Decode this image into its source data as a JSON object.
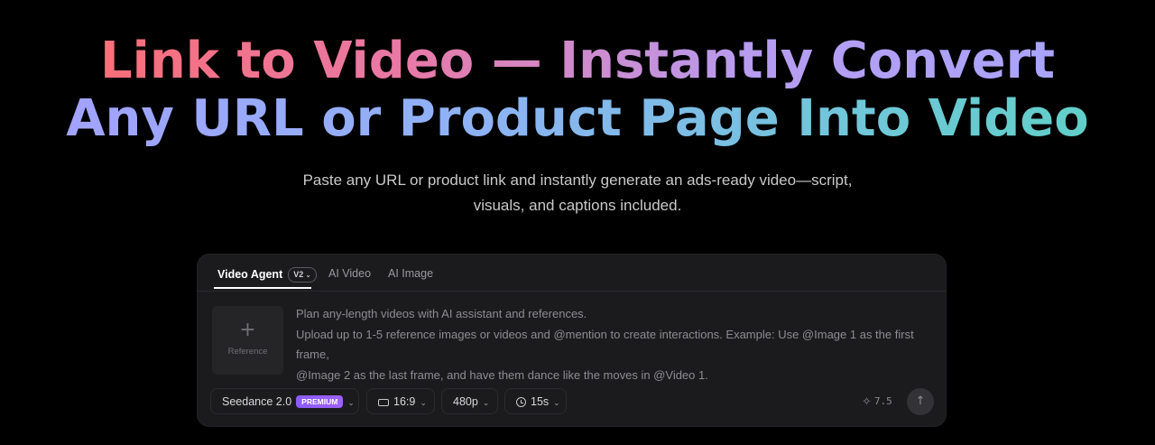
{
  "hero": {
    "title_line1": "Link to Video — Instantly Convert",
    "title_line2": "Any URL or Product Page Into Video",
    "subtitle_line1": "Paste any URL or product link and instantly generate an ads-ready video—script,",
    "subtitle_line2": "visuals, and captions included."
  },
  "panel": {
    "tabs": [
      {
        "label": "Video Agent",
        "badge": "V2",
        "active": true
      },
      {
        "label": "AI Video",
        "active": false
      },
      {
        "label": "AI Image",
        "active": false
      }
    ],
    "reference": {
      "icon": "plus-icon",
      "label": "Reference"
    },
    "prompt": {
      "line1": "Plan any-length videos with AI assistant and references.",
      "line2": "Upload up to 1-5 reference images or videos and @mention to create interactions. Example: Use @Image 1 as the first frame,",
      "line3": "@Image 2 as the last frame, and have them dance like the moves in @Video 1."
    },
    "toolbar": {
      "model": "Seedance 2.0",
      "model_badge": "PREMIUM",
      "aspect_ratio": "16:9",
      "resolution": "480p",
      "duration": "15s",
      "credits": "7.5"
    }
  },
  "colors": {
    "background": "#000000",
    "panel": "#1b1b1d",
    "premium_badge": "#8a5cf6"
  }
}
